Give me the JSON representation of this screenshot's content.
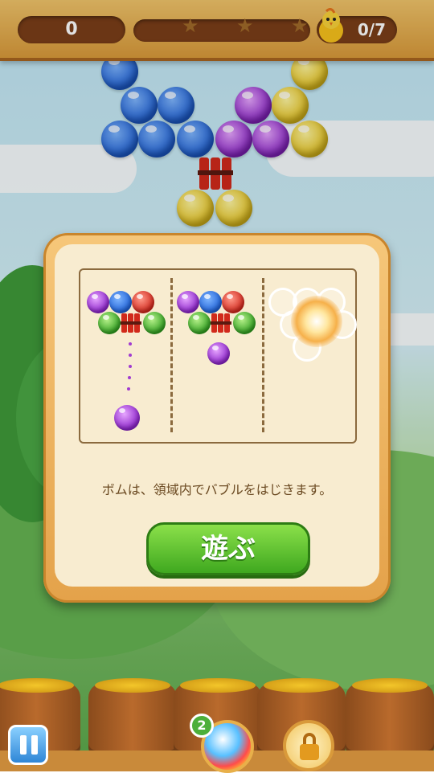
{
  "hud": {
    "score": "0",
    "goal_progress": "0/7",
    "stars_earned": 0,
    "stars_total": 3
  },
  "modal": {
    "description": "ボムは、領域内でバブルをはじきます。",
    "play_label": "遊ぶ"
  },
  "shooter": {
    "remaining_count": "2"
  },
  "colors": {
    "accent_green": "#3fa81f",
    "wood": "#d99a3a",
    "panel": "#f8ecd0"
  },
  "icons": [
    "star-icon",
    "chick-icon",
    "dynamite-icon",
    "pause-icon",
    "lock-icon"
  ]
}
